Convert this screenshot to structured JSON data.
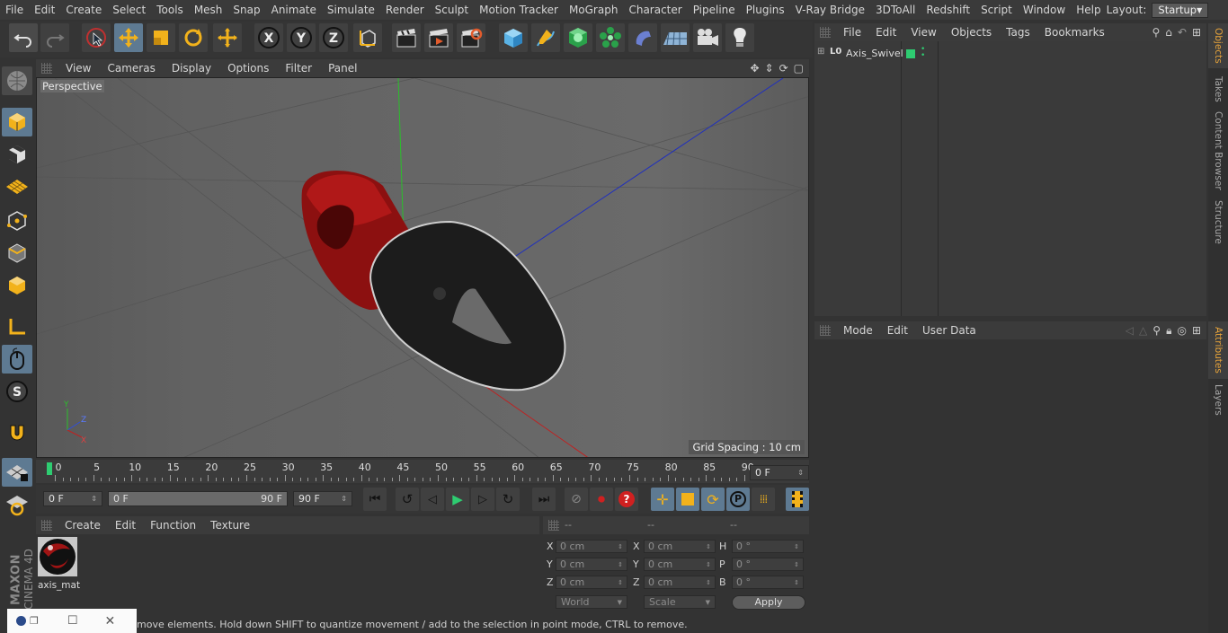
{
  "menubar": {
    "items": [
      "File",
      "Edit",
      "Create",
      "Select",
      "Tools",
      "Mesh",
      "Snap",
      "Animate",
      "Simulate",
      "Render",
      "Sculpt",
      "Motion Tracker",
      "MoGraph",
      "Character",
      "Pipeline",
      "Plugins",
      "V-Ray Bridge",
      "3DToAll",
      "Redshift",
      "Script",
      "Window",
      "Help"
    ],
    "layout_label": "Layout:",
    "layout_value": "Startup"
  },
  "viewport": {
    "menu": [
      "View",
      "Cameras",
      "Display",
      "Options",
      "Filter",
      "Panel"
    ],
    "label": "Perspective",
    "grid_spacing": "Grid Spacing : 10 cm"
  },
  "timeline": {
    "ticks": [
      "0",
      "5",
      "10",
      "15",
      "20",
      "25",
      "30",
      "35",
      "40",
      "45",
      "50",
      "55",
      "60",
      "65",
      "70",
      "75",
      "80",
      "85",
      "90"
    ],
    "current_frame": "0 F"
  },
  "transport": {
    "start_field": "0 F",
    "range_start": "0 F",
    "range_end": "90 F",
    "end_field": "90 F"
  },
  "material_manager": {
    "menu": [
      "Create",
      "Edit",
      "Function",
      "Texture"
    ],
    "material_name": "axis_mat"
  },
  "coordinates": {
    "headers": [
      "--",
      "--",
      "--"
    ],
    "rows": [
      {
        "l1": "X",
        "v1": "0 cm",
        "l2": "X",
        "v2": "0 cm",
        "l3": "H",
        "v3": "0 °"
      },
      {
        "l1": "Y",
        "v1": "0 cm",
        "l2": "Y",
        "v2": "0 cm",
        "l3": "P",
        "v3": "0 °"
      },
      {
        "l1": "Z",
        "v1": "0 cm",
        "l2": "Z",
        "v2": "0 cm",
        "l3": "B",
        "v3": "0 °"
      }
    ],
    "space_select": "World",
    "mode_select": "Scale",
    "apply_label": "Apply"
  },
  "object_manager": {
    "menu": [
      "File",
      "Edit",
      "View",
      "Objects",
      "Tags",
      "Bookmarks"
    ],
    "objects": [
      {
        "name": "Axis_Swivel"
      }
    ]
  },
  "attribute_manager": {
    "menu": [
      "Mode",
      "Edit",
      "User Data"
    ]
  },
  "side_tabs": [
    "Objects",
    "Takes",
    "Content Browser",
    "Structure"
  ],
  "attr_side_tabs": [
    "Attributes",
    "Layers"
  ],
  "branding": {
    "vendor": "MAXON",
    "product": "CINEMA 4D"
  },
  "statusbar": {
    "text": "move elements. Hold down SHIFT to quantize movement / add to the selection in point mode, CTRL to remove."
  },
  "colors": {
    "accent": "#5e7a92",
    "red_object": "#9b1414",
    "black_object": "#1a1a1a",
    "highlight": "#e8a43a"
  }
}
